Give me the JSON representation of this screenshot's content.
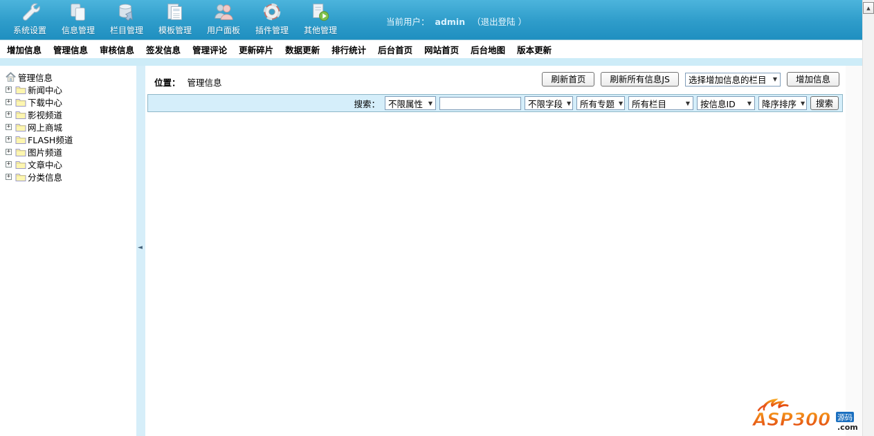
{
  "header": {
    "nav_items": [
      {
        "label": "系统设置",
        "icon": "wrench-icon"
      },
      {
        "label": "信息管理",
        "icon": "documents-icon"
      },
      {
        "label": "栏目管理",
        "icon": "database-icon"
      },
      {
        "label": "模板管理",
        "icon": "template-icon"
      },
      {
        "label": "用户面板",
        "icon": "users-icon"
      },
      {
        "label": "插件管理",
        "icon": "lifering-icon"
      },
      {
        "label": "其他管理",
        "icon": "doc-play-icon"
      }
    ],
    "user": {
      "prefix": "当前用户：",
      "name": "admin",
      "logout": "（退出登陆 ）"
    }
  },
  "menubar": {
    "items": [
      "增加信息",
      "管理信息",
      "审核信息",
      "签发信息",
      "管理评论",
      "更新碎片",
      "数据更新",
      "排行统计",
      "后台首页",
      "网站首页",
      "后台地图",
      "版本更新"
    ]
  },
  "sidebar": {
    "root_label": "管理信息",
    "folders": [
      "新闻中心",
      "下载中心",
      "影视频道",
      "网上商城",
      "FLASH频道",
      "图片频道",
      "文章中心",
      "分类信息"
    ],
    "expand_glyph": "+"
  },
  "content": {
    "breadcrumb": {
      "label": "位置：",
      "value": "管理信息"
    },
    "actions": {
      "refresh_home": "刷新首页",
      "refresh_all_js": "刷新所有信息JS",
      "column_select": "选择增加信息的栏目",
      "add_info": "增加信息"
    },
    "search": {
      "label": "搜索：",
      "attribute_select": "不限属性",
      "keyword_value": "",
      "field_select": "不限字段",
      "topic_select": "所有专题",
      "column_select": "所有栏目",
      "order_by_select": "按信息ID",
      "order_dir_select": "降序排序",
      "submit": "搜索"
    }
  },
  "scrollbar": {
    "up_glyph": "▲"
  },
  "divider": {
    "collapse_glyph": "◄"
  },
  "footer_logo": {
    "text": "ASP300",
    "badge": "源码",
    "suffix": ".com"
  },
  "colors": {
    "header_top": "#4cb4dc",
    "header_bottom": "#1f8fc0",
    "strip_blue": "#cdecf8",
    "search_bg": "#d5eefa",
    "search_border": "#8db6c7",
    "folder_yellow": "#fdf6b0",
    "logo_orange": "#e8541c",
    "logo_blue": "#1a6fbf"
  }
}
